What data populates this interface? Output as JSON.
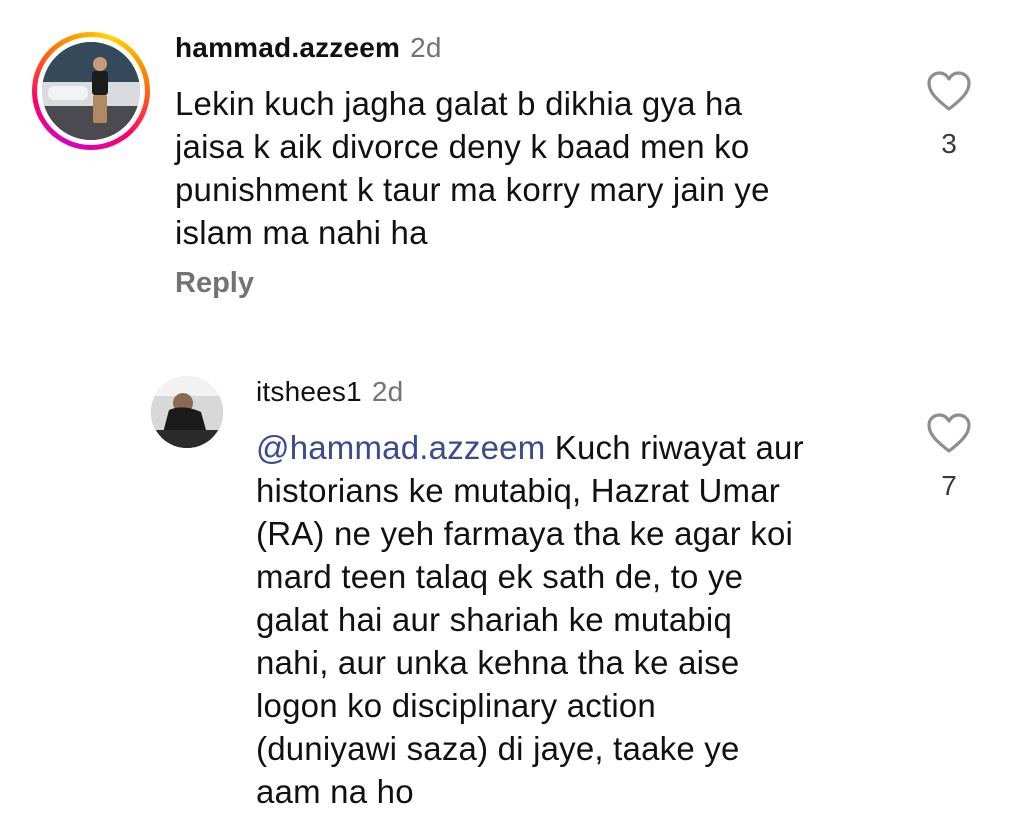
{
  "comments": [
    {
      "username": "hammad.azzeem",
      "age": "2d",
      "lines": [
        "Lekin kuch jagha galat b dikhia gya ha",
        "jaisa k aik divorce deny k baad men ko",
        "punishment k taur ma korry mary jain ye",
        "islam ma nahi ha"
      ],
      "likes": "3",
      "reply_label": "Reply",
      "avatar_icon": "profile-photo-with-story-ring"
    },
    {
      "username": "itshees1",
      "age": "2d",
      "mention": "@hammad.azzeem",
      "first_line_rest": " Kuch riwayat aur",
      "lines": [
        "historians ke mutabiq, Hazrat Umar",
        "(RA) ne yeh farmaya tha ke agar koi",
        "mard teen talaq ek sath de, to ye",
        "galat hai aur shariah ke mutabiq",
        "nahi, aur unka kehna tha ke aise",
        "logon ko disciplinary action",
        "(duniyawi saza) di jaye, taake ye",
        "aam na ho"
      ],
      "likes": "7",
      "avatar_icon": "profile-photo"
    }
  ],
  "colors": {
    "text": "#111111",
    "secondary": "#737373",
    "mention": "#3c4a8f",
    "story_ring": [
      "#d300c5",
      "#ff0069",
      "#ff7a00",
      "#ffd600"
    ]
  },
  "icons": {
    "like": "heart-outline-icon"
  }
}
